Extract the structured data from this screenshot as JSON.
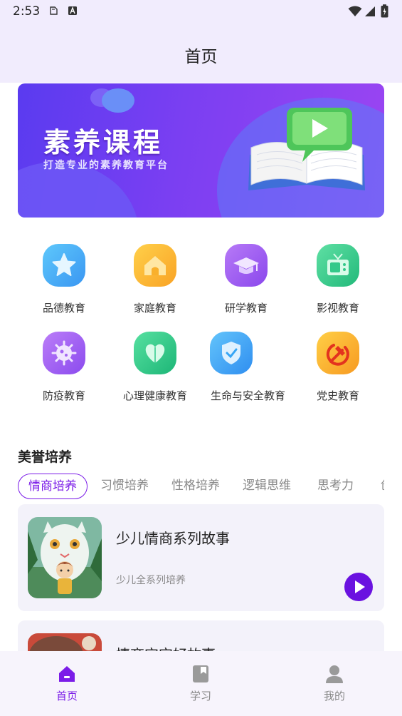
{
  "status": {
    "time": "2:53"
  },
  "header": {
    "title": "首页"
  },
  "banner": {
    "title": "素养课程",
    "subtitle": "打造专业的素养教育平台"
  },
  "categories": [
    {
      "label": "品德教育",
      "icon": "star-icon",
      "color": "#3aa8f5"
    },
    {
      "label": "家庭教育",
      "icon": "house-icon",
      "color": "#f9b02c"
    },
    {
      "label": "研学教育",
      "icon": "graduation-cap-icon",
      "color": "#9a5cf0"
    },
    {
      "label": "影视教育",
      "icon": "tv-icon",
      "color": "#33c98a"
    },
    {
      "label": "防疫教育",
      "icon": "virus-icon",
      "color": "#9b5cf2"
    },
    {
      "label": "心理健康教育",
      "icon": "heart-icon",
      "color": "#2fc98a"
    },
    {
      "label": "生命与安全教育",
      "icon": "shield-icon",
      "color": "#36a5f5"
    },
    {
      "label": "党史教育",
      "icon": "hammer-sickle-icon",
      "color": "#f8a52b"
    }
  ],
  "section": {
    "title": "美誉培养"
  },
  "tabs": [
    "情商培养",
    "习惯培养",
    "性格培养",
    "逻辑思维",
    "思考力",
    "创"
  ],
  "courses": [
    {
      "title": "少儿情商系列故事",
      "subtitle": "少儿全系列培养"
    },
    {
      "title": "情商宝宝好故事",
      "subtitle": ""
    }
  ],
  "nav": [
    {
      "label": "首页",
      "icon": "home-icon",
      "active": true
    },
    {
      "label": "学习",
      "icon": "book-icon",
      "active": false
    },
    {
      "label": "我的",
      "icon": "user-icon",
      "active": false
    }
  ],
  "colors": {
    "accent": "#7b1ce8",
    "header_bg": "#f1ecfd",
    "card_bg": "#f3f2fa"
  }
}
